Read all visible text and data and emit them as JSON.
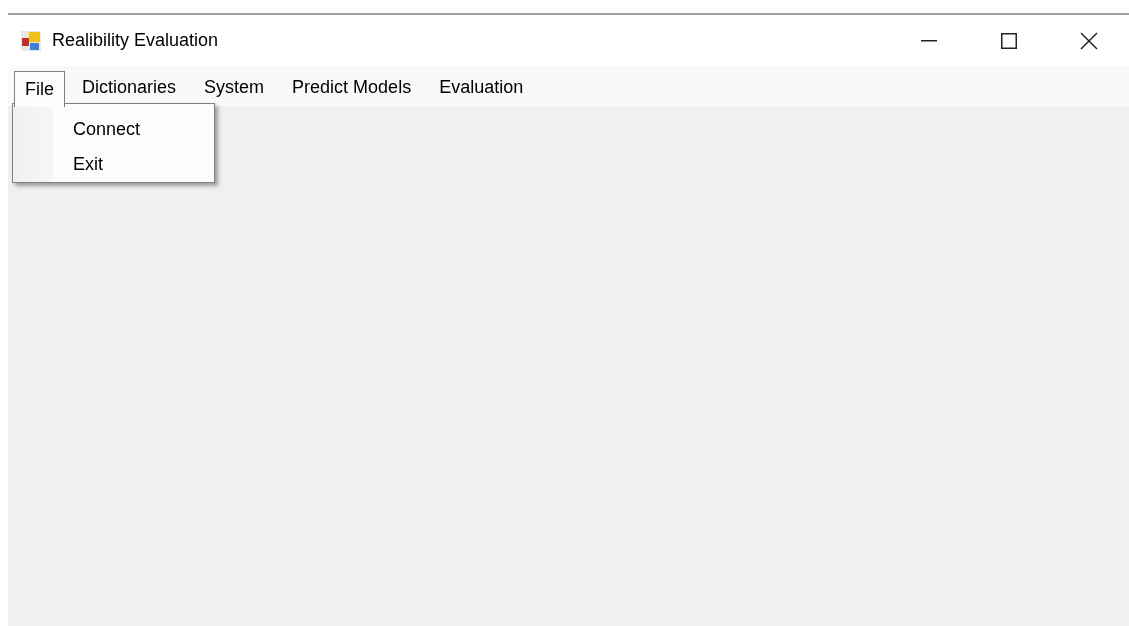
{
  "window": {
    "title": "Realibility Evaluation"
  },
  "menu": [
    {
      "label": "File",
      "selected": true
    },
    {
      "label": "Dictionaries",
      "selected": false
    },
    {
      "label": "System",
      "selected": false
    },
    {
      "label": "Predict Models",
      "selected": false
    },
    {
      "label": "Evaluation",
      "selected": false
    }
  ],
  "dropdown": {
    "items": [
      {
        "label": "Connect"
      },
      {
        "label": "Exit"
      }
    ]
  }
}
